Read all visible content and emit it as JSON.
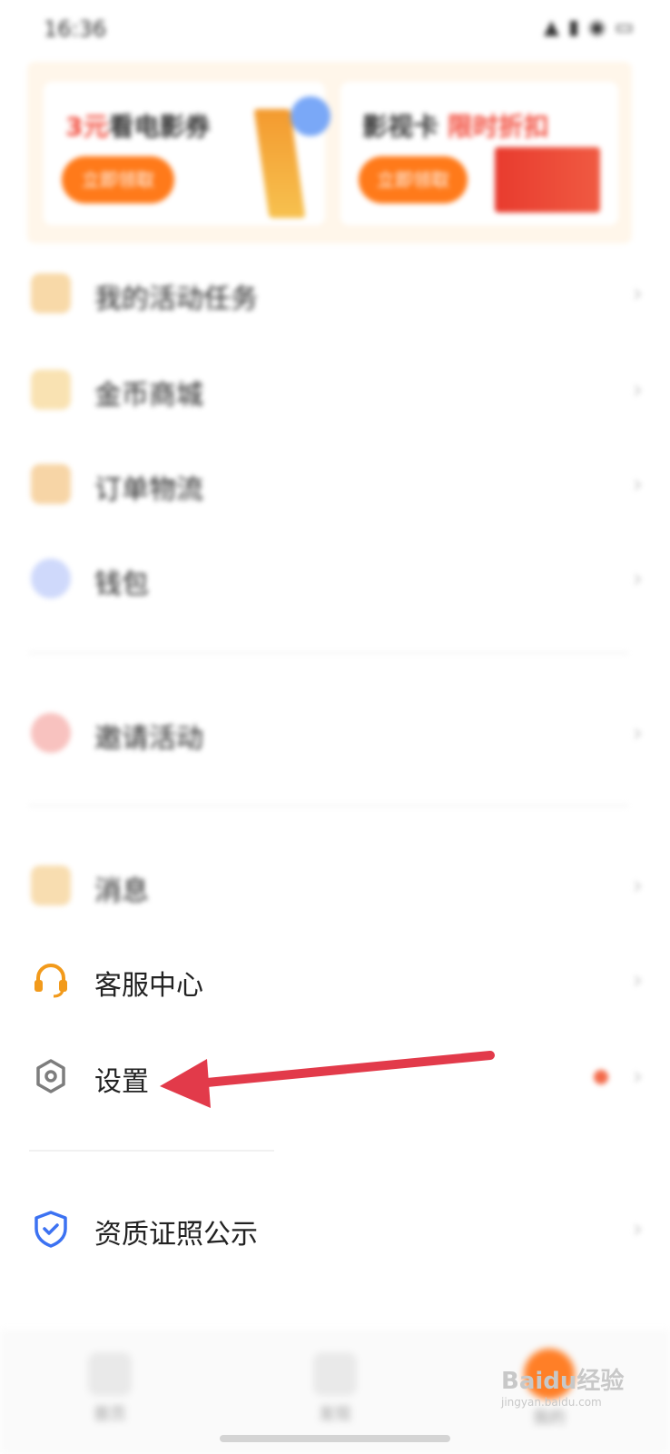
{
  "status_bar": {
    "time": "16:36",
    "icons": [
      "signal-icon",
      "sim-icon",
      "wifi-icon",
      "battery-icon"
    ]
  },
  "banner": {
    "left_card": {
      "title_highlight": "3元",
      "title_rest": "看电影券",
      "button": "立即领取"
    },
    "right_card": {
      "title_rest": "影视卡",
      "title_highlight": "限时折扣",
      "button": "立即领取"
    }
  },
  "menu": {
    "group1": [
      {
        "label": "我的活动任务",
        "icon": "task-icon",
        "color": "#f8d9a8"
      },
      {
        "label": "金币商城",
        "icon": "coin-icon",
        "color": "#f9e2b2"
      },
      {
        "label": "订单物流",
        "icon": "order-icon",
        "color": "#f7d5a6"
      },
      {
        "label": "钱包",
        "icon": "wallet-icon",
        "color": "#cfd9fb"
      }
    ],
    "group2": [
      {
        "label": "邀请活动",
        "icon": "invite-icon",
        "color": "#f8c2bf"
      }
    ],
    "group3": [
      {
        "label": "消息",
        "icon": "message-icon",
        "color": "#f8ddb0"
      },
      {
        "label": "客服中心",
        "icon": "headset-icon",
        "color": "#f29a1b"
      },
      {
        "label": "设置",
        "icon": "gear-icon",
        "color": "#7d7d7d"
      }
    ],
    "group4": [
      {
        "label": "资质证照公示",
        "icon": "shield-check-icon",
        "color": "#3c72f2"
      }
    ]
  },
  "annotation": {
    "arrow_color": "#e23a4a"
  },
  "bottom_nav": [
    {
      "label": "首页",
      "icon": "home-icon"
    },
    {
      "label": "发现",
      "icon": "discover-icon"
    },
    {
      "label": "我的",
      "icon": "profile-icon"
    }
  ],
  "watermark": {
    "brand": "Baidu经验",
    "url": "jingyan.baidu.com"
  }
}
